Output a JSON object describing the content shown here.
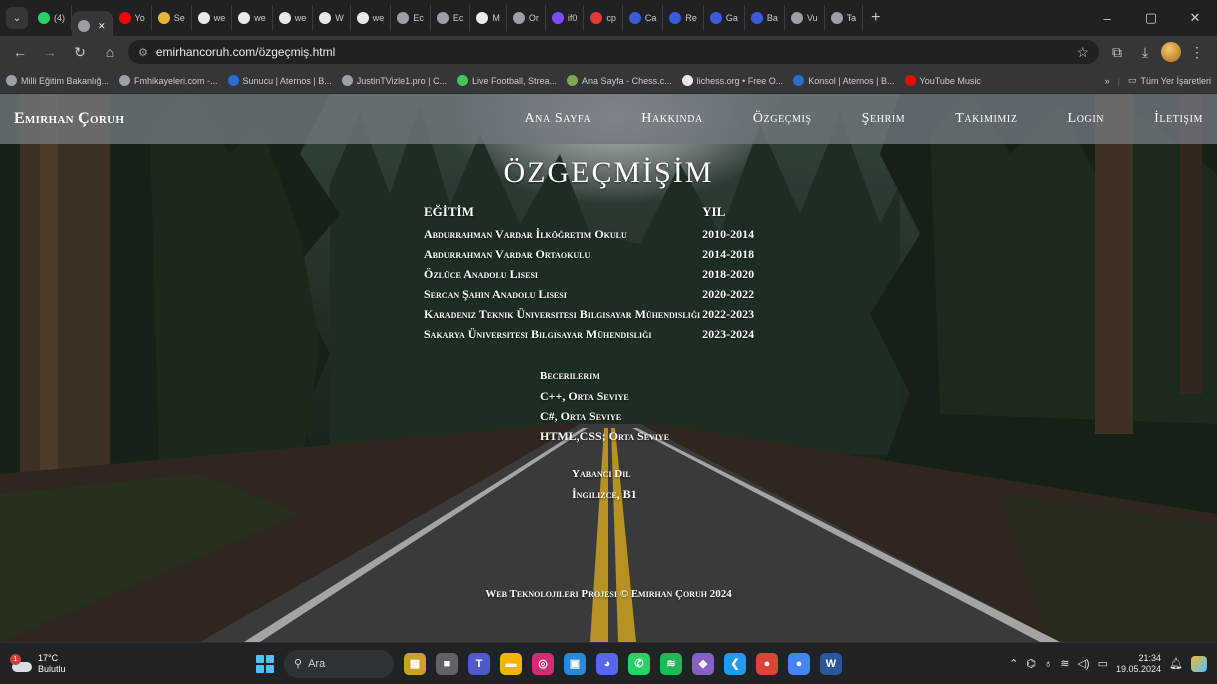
{
  "browser": {
    "tabs": [
      {
        "label": "(4)",
        "color": "#25d366"
      },
      {
        "label": "",
        "color": "#9aa0a6",
        "active": true,
        "close": "✕"
      },
      {
        "label": "Yo",
        "color": "#ff0000"
      },
      {
        "label": "Se",
        "color": "#e8b23b"
      },
      {
        "label": "we",
        "color": "#e8eaed"
      },
      {
        "label": "we",
        "color": "#e8eaed"
      },
      {
        "label": "we",
        "color": "#e8eaed"
      },
      {
        "label": "W",
        "color": "#e8eaed"
      },
      {
        "label": "we",
        "color": "#e8eaed"
      },
      {
        "label": "Ec",
        "color": "#9aa0a6"
      },
      {
        "label": "Ec",
        "color": "#9aa0a6"
      },
      {
        "label": "M",
        "color": "#e8eaed"
      },
      {
        "label": "Or",
        "color": "#9aa0a6"
      },
      {
        "label": "if0",
        "color": "#7c4dff"
      },
      {
        "label": "cp",
        "color": "#e53935"
      },
      {
        "label": "Ca",
        "color": "#3b5bdb"
      },
      {
        "label": "Re",
        "color": "#3b5bdb"
      },
      {
        "label": "Ga",
        "color": "#3b5bdb"
      },
      {
        "label": "Ba",
        "color": "#3b5bdb"
      },
      {
        "label": "Vu",
        "color": "#9aa0a6"
      },
      {
        "label": "Ta",
        "color": "#9aa0a6"
      }
    ],
    "new_tab": "+",
    "window_controls": {
      "minimize": "–",
      "restore": "▢",
      "close": "✕"
    },
    "url": "emirhancoruh.com/özgeçmiş.html",
    "bookmarks": [
      {
        "label": "Milli Eğitim Bakanlığ...",
        "color": "#9aa0a6"
      },
      {
        "label": "Fmhikayeleri.com -...",
        "color": "#9aa0a6"
      },
      {
        "label": "Sunucu | Aternos | B...",
        "color": "#2a6dd1"
      },
      {
        "label": "JustinTVizle1.pro | C...",
        "color": "#9aa0a6"
      },
      {
        "label": "Live Football, Strea...",
        "color": "#43c463"
      },
      {
        "label": "Ana Sayfa - Chess.c...",
        "color": "#7fa650"
      },
      {
        "label": "lichess.org • Free O...",
        "color": "#e8eaed"
      },
      {
        "label": "Konsol | Aternos | B...",
        "color": "#2a6dd1"
      },
      {
        "label": "YouTube Music",
        "color": "#ff0000"
      }
    ],
    "bookmarks_overflow": "»",
    "all_bookmarks": "Tüm Yer İşaretleri"
  },
  "site": {
    "brand": "Emirhan Çoruh",
    "nav": [
      "Ana Sayfa",
      "Hakkında",
      "Özgeçmiş",
      "Şehrim",
      "Takımımız",
      "Login",
      "İletişim"
    ],
    "title": "ÖZGEÇMİŞİM",
    "education_header": "EĞİTİM",
    "year_header": "YIL",
    "education": [
      {
        "school": "Abdurrahman Vardar İlköğretim Okulu",
        "years": "2010-2014"
      },
      {
        "school": "Abdurrahman Vardar Ortaokulu",
        "years": "2014-2018"
      },
      {
        "school": "Özlüce Anadolu Lisesi",
        "years": "2018-2020"
      },
      {
        "school": "Sercan Şahin Anadolu Lisesi",
        "years": "2020-2022"
      },
      {
        "school": "Karadeniz Teknik Üniversitesi Bilgisayar Mühendisliği",
        "years": "2022-2023"
      },
      {
        "school": "Sakarya Üniversitesi Bilgisayar Mühendisliği",
        "years": "2023-2024"
      }
    ],
    "skills_header": "Becerilerim",
    "skills": [
      "C++, Orta Seviye",
      "C#, Orta Seviye",
      "HTML,CSS; Orta Seviye"
    ],
    "language_header": "Yabancı Dil",
    "languages": [
      "İngilizce, B1"
    ],
    "footer": "Web Teknolojileri Projesi © Emirhan Çoruh 2024"
  },
  "taskbar": {
    "weather_temp": "17°C",
    "weather_desc": "Bulutlu",
    "weather_badge": "1",
    "search_label": "Ara",
    "apps": [
      {
        "name": "widgets",
        "color": "#c9a227",
        "glyph": "▦"
      },
      {
        "name": "file-viewer",
        "color": "#5f6368",
        "glyph": "■"
      },
      {
        "name": "teams",
        "color": "#5059c9",
        "glyph": "T"
      },
      {
        "name": "file-explorer",
        "color": "#f4b400",
        "glyph": "▬"
      },
      {
        "name": "instagram",
        "color": "#d62976",
        "glyph": "◎"
      },
      {
        "name": "store",
        "color": "#2b88d8",
        "glyph": "▣"
      },
      {
        "name": "discord",
        "color": "#5865f2",
        "glyph": "◕"
      },
      {
        "name": "whatsapp",
        "color": "#25d366",
        "glyph": "✆"
      },
      {
        "name": "spotify",
        "color": "#1db954",
        "glyph": "≋"
      },
      {
        "name": "visual-studio",
        "color": "#8661c5",
        "glyph": "◆"
      },
      {
        "name": "vscode",
        "color": "#1f9cf0",
        "glyph": "❮"
      },
      {
        "name": "chrome",
        "color": "#db4437",
        "glyph": "●"
      },
      {
        "name": "chrome-profile",
        "color": "#4285f4",
        "glyph": "●"
      },
      {
        "name": "word",
        "color": "#2b579a",
        "glyph": "W"
      }
    ],
    "time": "21:34",
    "date": "19.05.2024"
  }
}
